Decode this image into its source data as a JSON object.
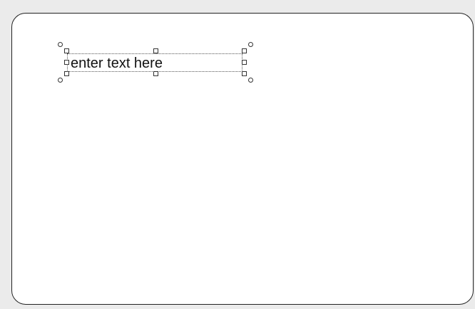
{
  "canvas": {
    "background_color": "#ffffff",
    "border_color": "#222222",
    "page_background_color": "#ebebeb"
  },
  "text_object": {
    "text": "enter text here",
    "selected": true
  }
}
